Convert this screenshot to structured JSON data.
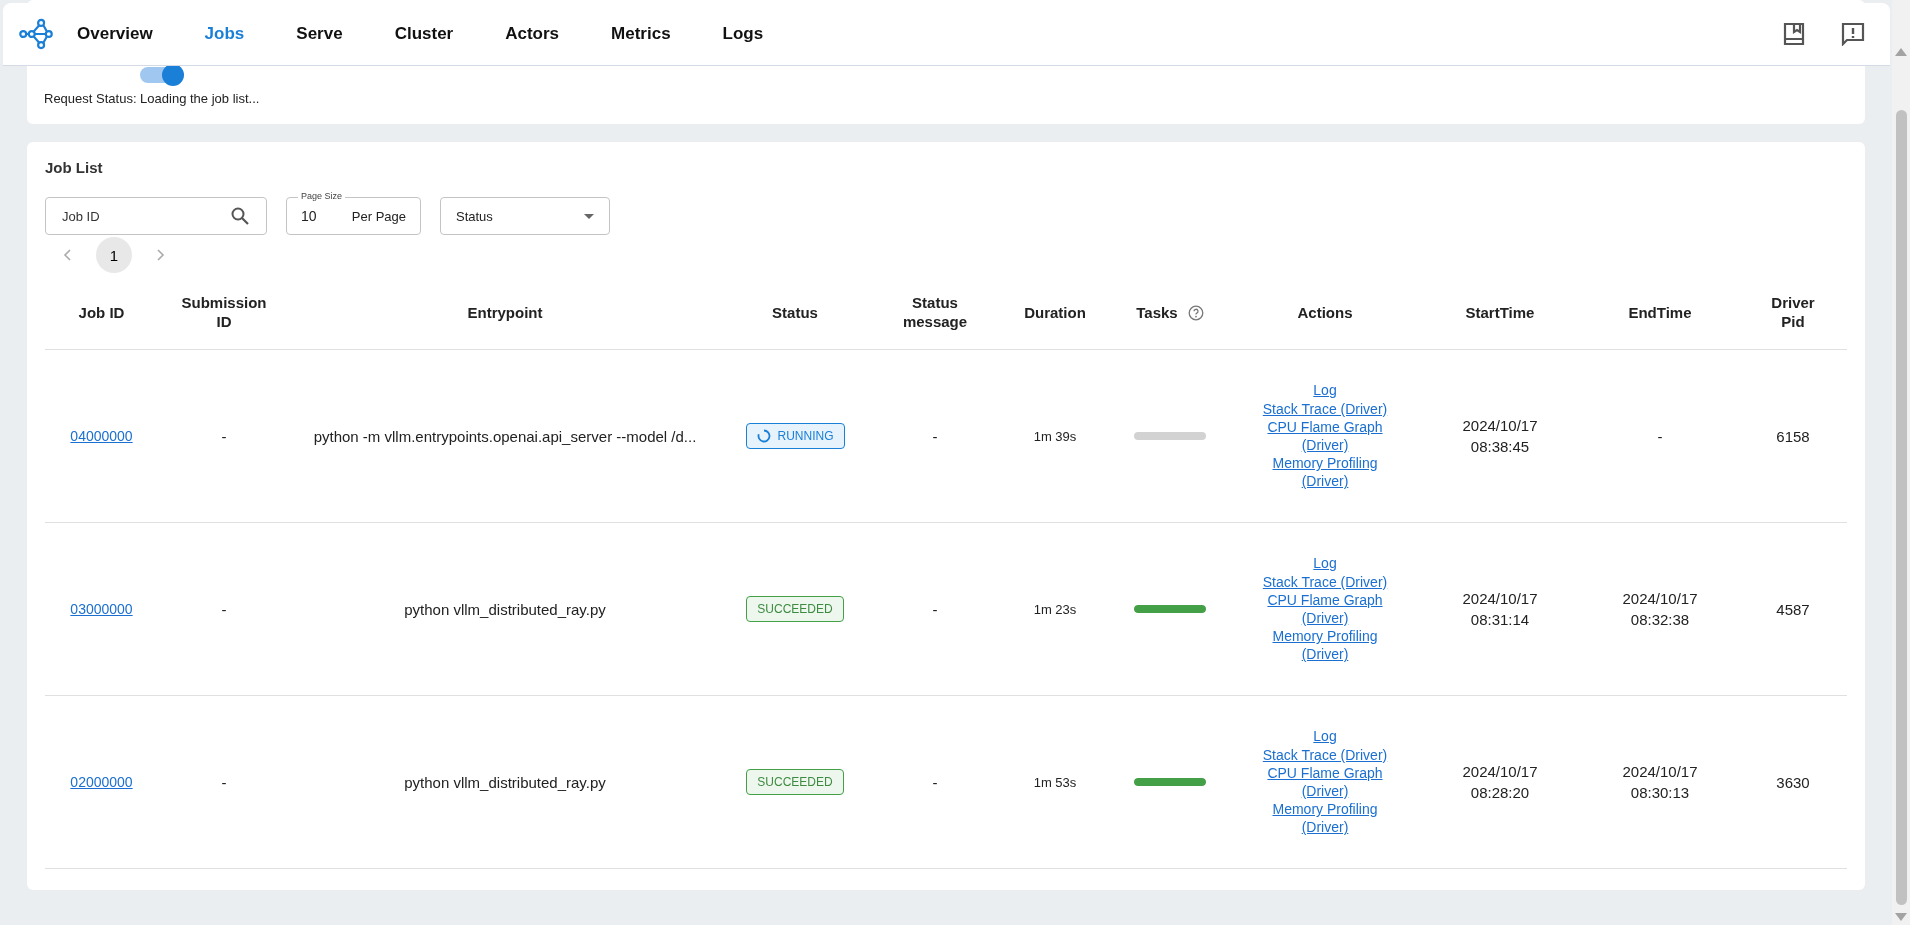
{
  "nav": {
    "items": [
      {
        "label": "Overview",
        "selected": false
      },
      {
        "label": "Jobs",
        "selected": true
      },
      {
        "label": "Serve",
        "selected": false
      },
      {
        "label": "Cluster",
        "selected": false
      },
      {
        "label": "Actors",
        "selected": false
      },
      {
        "label": "Metrics",
        "selected": false
      },
      {
        "label": "Logs",
        "selected": false
      }
    ]
  },
  "refresh": {
    "auto_refresh_on": true,
    "request_status": "Request Status: Loading the job list..."
  },
  "job_list": {
    "title": "Job List",
    "search": {
      "placeholder": "Job ID"
    },
    "page_size": {
      "label": "Page Size",
      "value": "10",
      "suffix": "Per Page"
    },
    "status_filter": {
      "placeholder": "Status"
    },
    "pagination": {
      "pages": [
        {
          "label": "1",
          "selected": true
        }
      ]
    },
    "columns": [
      "Job ID",
      "Submission ID",
      "Entrypoint",
      "Status",
      "Status message",
      "Duration",
      "Tasks",
      "Actions",
      "StartTime",
      "EndTime",
      "Driver Pid"
    ],
    "rows": [
      {
        "job_id": "04000000",
        "submission_id": "-",
        "entrypoint": "python -m vllm.entrypoints.openai.api_server --model /d...",
        "status": {
          "kind": "running",
          "label": "RUNNING"
        },
        "status_message": "-",
        "duration": "1m 39s",
        "tasks": {
          "kind": "running",
          "level": 0
        },
        "actions": [
          "Log",
          "Stack Trace (Driver)",
          "CPU Flame Graph (Driver)",
          "Memory Profiling (Driver)"
        ],
        "start_time": "2024/10/17 08:38:45",
        "end_time": "-",
        "driver_pid": "6158"
      },
      {
        "job_id": "03000000",
        "submission_id": "-",
        "entrypoint": "python vllm_distributed_ray.py",
        "status": {
          "kind": "succeeded",
          "label": "SUCCEEDED"
        },
        "status_message": "-",
        "duration": "1m 23s",
        "tasks": {
          "kind": "succeeded",
          "level": 1
        },
        "actions": [
          "Log",
          "Stack Trace (Driver)",
          "CPU Flame Graph (Driver)",
          "Memory Profiling (Driver)"
        ],
        "start_time": "2024/10/17 08:31:14",
        "end_time": "2024/10/17 08:32:38",
        "driver_pid": "4587"
      },
      {
        "job_id": "02000000",
        "submission_id": "-",
        "entrypoint": "python vllm_distributed_ray.py",
        "status": {
          "kind": "succeeded",
          "label": "SUCCEEDED"
        },
        "status_message": "-",
        "duration": "1m 53s",
        "tasks": {
          "kind": "succeeded",
          "level": 1
        },
        "actions": [
          "Log",
          "Stack Trace (Driver)",
          "CPU Flame Graph (Driver)",
          "Memory Profiling (Driver)"
        ],
        "start_time": "2024/10/17 08:28:20",
        "end_time": "2024/10/17 08:30:13",
        "driver_pid": "3630"
      }
    ]
  }
}
